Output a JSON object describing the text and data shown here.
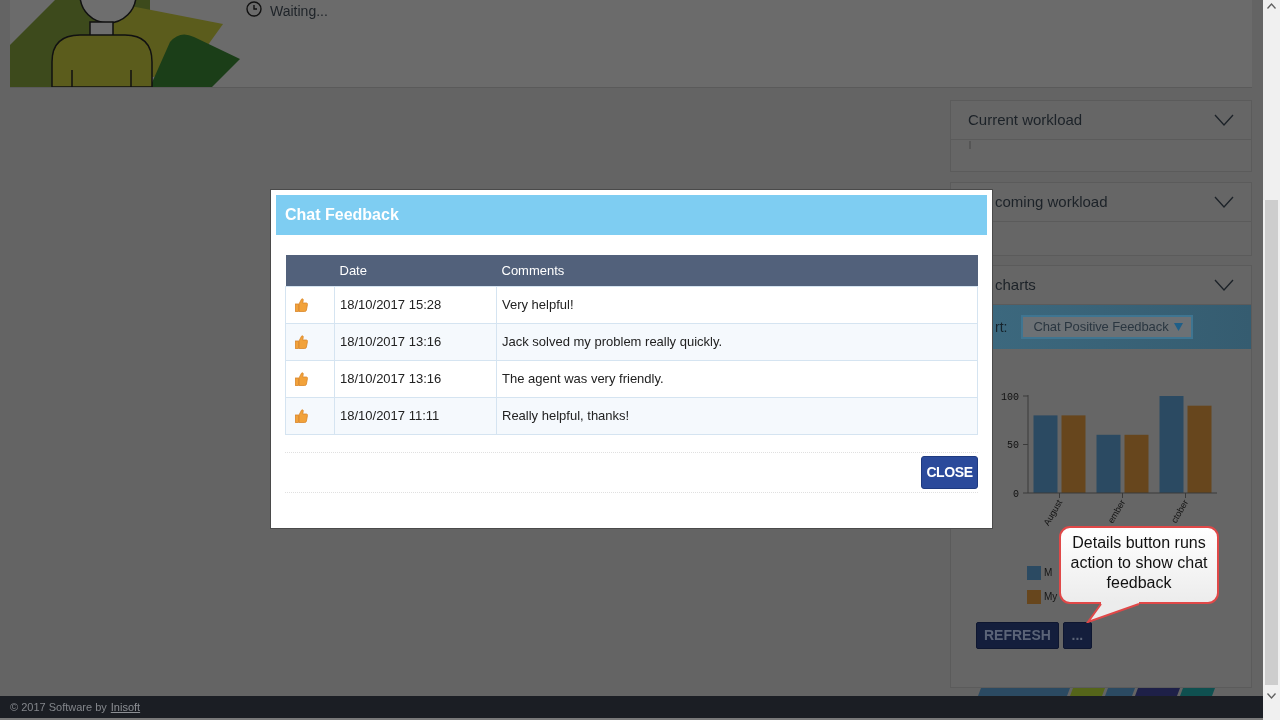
{
  "header": {
    "status": "Waiting..."
  },
  "panels": [
    {
      "title": "Current workload"
    },
    {
      "title": "coming workload"
    }
  ],
  "chart_panel": {
    "title": "charts",
    "chart_label": "rt:",
    "chart_select": "Chat Positive Feedback",
    "chart_data": {
      "type": "bar",
      "categories": [
        "August",
        "ember",
        "ctober"
      ],
      "series": [
        {
          "name": "M",
          "color": "#2b4a62",
          "values": [
            80,
            60,
            100
          ]
        },
        {
          "name": "My",
          "color": "#67461d",
          "values": [
            80,
            60,
            90
          ]
        }
      ],
      "ylim": [
        0,
        100
      ],
      "yticks": [
        0,
        50,
        100
      ]
    },
    "buttons": [
      "REFRESH",
      "..."
    ]
  },
  "footer": {
    "copyright": "© 2017 Software by",
    "link": "Inisoft"
  },
  "modal": {
    "title": "Chat Feedback",
    "columns": [
      "Date",
      "Comments"
    ],
    "rows": [
      {
        "date": "18/10/2017 15:28",
        "comment": "Very helpful!"
      },
      {
        "date": "18/10/2017 13:16",
        "comment": "Jack solved my problem really quickly."
      },
      {
        "date": "18/10/2017 13:16",
        "comment": "The agent was very friendly."
      },
      {
        "date": "18/10/2017 11:11",
        "comment": "Really helpful, thanks!"
      }
    ],
    "buttons": [
      "CLOSE"
    ]
  },
  "callout": {
    "text": "Details button runs action to show chat feedback"
  }
}
